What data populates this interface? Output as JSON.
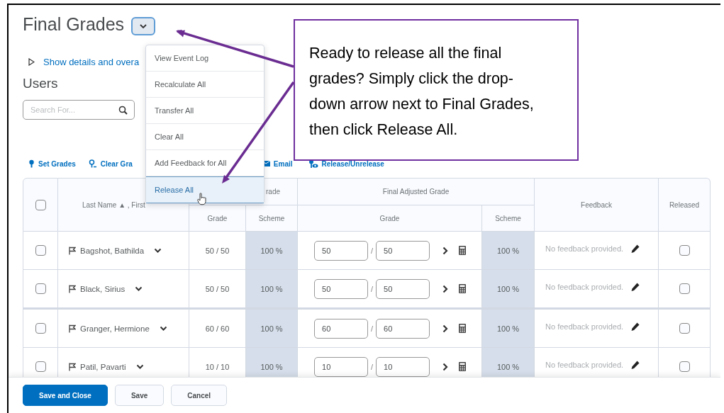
{
  "title": "Final Grades",
  "details_link": "Show details and overa",
  "users_heading": "Users",
  "search": {
    "placeholder": "Search For..."
  },
  "menu": {
    "items": [
      {
        "label": "View Event Log",
        "selected": false
      },
      {
        "label": "Recalculate All",
        "selected": false
      },
      {
        "label": "Transfer All",
        "selected": false
      },
      {
        "label": "Clear All",
        "selected": false
      },
      {
        "label": "Add Feedback for All",
        "selected": false
      },
      {
        "label": "Release All",
        "selected": true
      }
    ]
  },
  "callout": "Ready to release all the final grades? Simply click the drop-down arrow next to Final Grades, then click Release All.",
  "toolbar": [
    {
      "label": "Set Grades",
      "kind": "set"
    },
    {
      "label": "Clear Gra",
      "kind": "clear"
    },
    {
      "label": "Email",
      "kind": "email"
    },
    {
      "label": "Release/Unrelease",
      "kind": "release"
    }
  ],
  "table": {
    "name_header": "Last Name ▲ , First",
    "grade_group": "rade",
    "grade_header": "Grade",
    "scheme_header": "Scheme",
    "adjusted_group": "Final Adjusted Grade",
    "adjusted_grade_header": "Grade",
    "adjusted_scheme_header": "Scheme",
    "feedback_header": "Feedback",
    "released_header": "Released",
    "select_all_checked": false,
    "separator": "/",
    "rows": [
      {
        "name": "Bagshot, Bathilda",
        "grade": "50 / 50",
        "scheme": "100 %",
        "adjusted": "50",
        "adjusted_max": "50",
        "adjusted_scheme": "100 %",
        "feedback": "No feedback provided.",
        "checked": false,
        "released": false
      },
      {
        "name": "Black, Sirius",
        "grade": "50 / 50",
        "scheme": "100 %",
        "adjusted": "50",
        "adjusted_max": "50",
        "adjusted_scheme": "100 %",
        "feedback": "No feedback provided.",
        "checked": false,
        "released": false
      },
      {
        "name": "Granger, Hermione",
        "grade": "60 / 60",
        "scheme": "100 %",
        "adjusted": "60",
        "adjusted_max": "60",
        "adjusted_scheme": "100 %",
        "feedback": "No feedback provided.",
        "checked": false,
        "released": false
      },
      {
        "name": "Patil, Pavarti",
        "grade": "10 / 10",
        "scheme": "100 %",
        "adjusted": "10",
        "adjusted_max": "10",
        "adjusted_scheme": "100 %",
        "feedback": "No feedback provided.",
        "checked": false,
        "released": false
      }
    ]
  },
  "footer": {
    "buttons": [
      {
        "label": "Save and Close",
        "kind": "primary"
      },
      {
        "label": "Save",
        "kind": "secondary"
      },
      {
        "label": "Cancel",
        "kind": "secondary"
      }
    ]
  }
}
